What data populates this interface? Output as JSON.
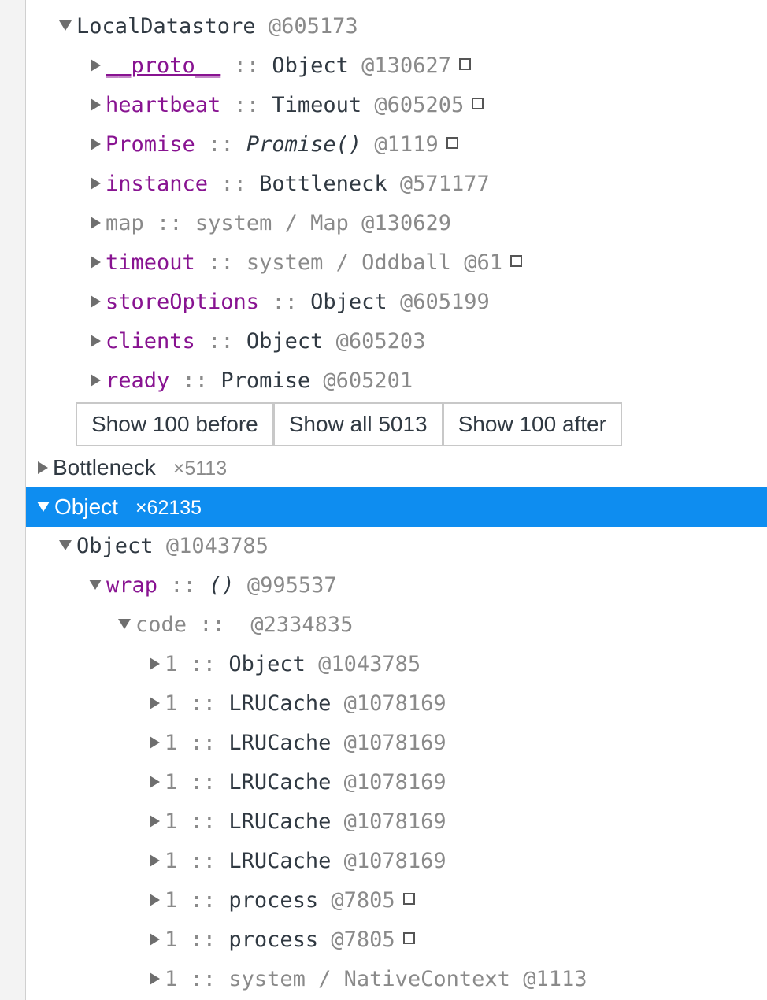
{
  "tree": {
    "local_datastore": {
      "name": "LocalDatastore",
      "id": "@605173"
    },
    "children": [
      {
        "name": "__proto__",
        "sep": "::",
        "type": "Object",
        "id": "@130627"
      },
      {
        "name": "heartbeat",
        "sep": "::",
        "type": "Timeout",
        "id": "@605205"
      },
      {
        "name": "Promise",
        "sep": "::",
        "type": "Promise()",
        "id": "@1119"
      },
      {
        "name": "instance",
        "sep": "::",
        "type": "Bottleneck",
        "id": "@571177"
      },
      {
        "name": "map",
        "sep": "::",
        "type": "system / Map",
        "id": "@130629"
      },
      {
        "name": "timeout",
        "sep": "::",
        "type": "system / Oddball",
        "id": "@61"
      },
      {
        "name": "storeOptions",
        "sep": "::",
        "type": "Object",
        "id": "@605199"
      },
      {
        "name": "clients",
        "sep": "::",
        "type": "Object",
        "id": "@605203"
      },
      {
        "name": "ready",
        "sep": "::",
        "type": "Promise",
        "id": "@605201"
      }
    ],
    "buttons": {
      "before": "Show 100 before",
      "all": "Show all 5013",
      "after": "Show 100 after"
    },
    "bottleneck_class": {
      "name": "Bottleneck",
      "count": "×5113"
    },
    "object_class": {
      "name": "Object",
      "count": "×62135"
    },
    "object_instance": {
      "name": "Object",
      "id": "@1043785"
    },
    "wrap": {
      "name": "wrap",
      "sep": "::",
      "type": "()",
      "id": "@995537"
    },
    "code": {
      "name": "code",
      "sep": "::",
      "id": "@2334835"
    },
    "code_children": [
      {
        "name": "1",
        "sep": "::",
        "type": "Object",
        "id": "@1043785"
      },
      {
        "name": "1",
        "sep": "::",
        "type": "LRUCache",
        "id": "@1078169"
      },
      {
        "name": "1",
        "sep": "::",
        "type": "LRUCache",
        "id": "@1078169"
      },
      {
        "name": "1",
        "sep": "::",
        "type": "LRUCache",
        "id": "@1078169"
      },
      {
        "name": "1",
        "sep": "::",
        "type": "LRUCache",
        "id": "@1078169"
      },
      {
        "name": "1",
        "sep": "::",
        "type": "LRUCache",
        "id": "@1078169"
      },
      {
        "name": "1",
        "sep": "::",
        "type": "process",
        "id": "@7805"
      },
      {
        "name": "1",
        "sep": "::",
        "type": "process",
        "id": "@7805"
      },
      {
        "name": "1",
        "sep": "::",
        "type": "system / NativeContext",
        "id": "@1113"
      }
    ]
  },
  "colors": {
    "selection": "#0e8df0",
    "property_name": "#881391",
    "muted": "#8a8a8a"
  },
  "icons": {
    "collapsed": "triangle-right-icon",
    "expanded": "triangle-down-icon",
    "detached": "square-outline-icon"
  }
}
